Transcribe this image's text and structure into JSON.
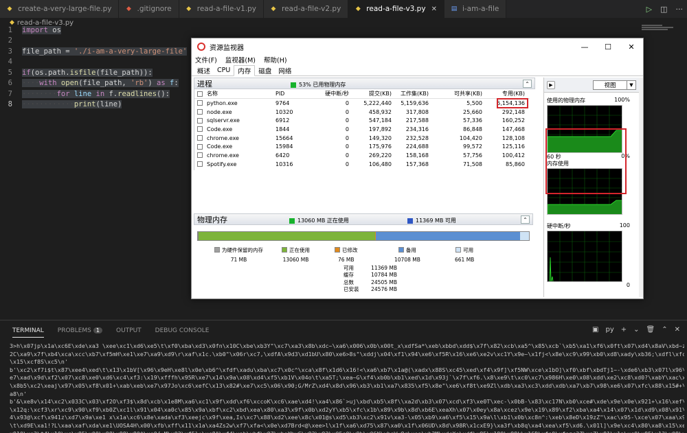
{
  "editor_tabs": [
    {
      "label": "create-a-very-large-file.py",
      "icon": "python-file-icon",
      "active": false
    },
    {
      "label": ".gitignore",
      "icon": "git-icon",
      "active": false
    },
    {
      "label": "read-a-file-v1.py",
      "icon": "python-file-icon",
      "active": false
    },
    {
      "label": "read-a-file-v2.py",
      "icon": "python-file-icon",
      "active": false
    },
    {
      "label": "read-a-file-v3.py",
      "icon": "python-file-icon",
      "active": true
    },
    {
      "label": "i-am-a-file",
      "icon": "file-icon",
      "active": false
    }
  ],
  "breadcrumb": "read-a-file-v3.py",
  "code_lines": [
    {
      "n": "1",
      "html": "<span class=\"kw\">import</span> os"
    },
    {
      "n": "2",
      "html": ""
    },
    {
      "n": "3",
      "html": "file_path = <span class=\"str\">'./i-am-a-very-large-file'</span>"
    },
    {
      "n": "4",
      "html": ""
    },
    {
      "n": "5",
      "html": "<span class=\"kw\">if</span>(os.path.<span class=\"fn\">isfile</span>(file_path)):"
    },
    {
      "n": "6",
      "html": "<span class=\"ws\">····</span><span class=\"kw\">with</span> <span class=\"fn\">open</span>(file_path, <span class=\"str\">'rb'</span>) <span class=\"kw\">as</span> <span class=\"var\">f</span>:"
    },
    {
      "n": "7",
      "html": "<span class=\"ws\">········</span><span class=\"kw\">for</span> <span class=\"var\">line</span> <span class=\"kw\">in</span> f.<span class=\"fn\">readlines</span>():"
    },
    {
      "n": "8",
      "html": "<span class=\"ws\">············</span><span class=\"fn\">print</span>(line)"
    }
  ],
  "panel": {
    "tabs": [
      "TERMINAL",
      "PROBLEMS",
      "OUTPUT",
      "DEBUG CONSOLE"
    ],
    "problems_count": "1",
    "shell": "py",
    "terminal_lines": [
      "3>h\\x07jp\\x1a\\xc6E\\xde\\xa3 \\xee\\xc1\\xd6\\xe5\\t\\xf0\\xba\\xd3\\x0fn\\x10C\\xbe\\xb3Y\"\\xc7\\xa3\\x8b\\xdc~\\xa6\\x006\\x0b\\x00t_x\\xdfSa*\\xeb\\xbbd\\xdd$\\x7f\\x82\\xcb\\xa5^\\x85\\xcb`\\xb5\\xa1\\xf6\\x0ft\\x07\\xd4\\x8aV\\xbd~zpQ3&W\\x81:\\xbfW\\x0e\\xf",
      "2C\\xa9\\x7f\\xb4\\xca\\xcc\\xb7\\xf5mH\\xe1\\xe7\\xa9\\xd9\\r\\xaf\\x1c.\\xb0\"\\x06r\\xc7,\\xdfA\\x9d3\\xd1bU\\x80\\xe6>8s\"\\xddj\\x04\\xf1\\x94\\xe6\\xf5R\\x16\\xe6\\xe2v\\xc1Y\\x9e~\\x1fj<\\x8e\\xc9\\x99\\xb0\\xd8\\xady\\xb36;\\xdfl\\xfcV\\xaaV\\x83\\x05k8[\\xc9",
      "\\x15\\xcf8S\\xc5\\n'",
      "b'\\xc2\\xf7i$t\\x87\\xee4\\xed\\t\\x13\\x1bV[\\x96\\x9eH\\xe8l\\x0e\\xb6^\\xfdf\\xadu\\xba\\xc7\\x0c^\\xca\\x8f\\x1d6\\x16!<\\xa6\\xb7\\x1a@(\\xadx\\x88S\\xc45\\xed\\xf4\\x9f]\\xf5NW\\xce\\x1bO]\\xf0\\xbf\\xbdTj1~-\\xde6\\xb3\\x07l\\x96\\xea\\xa1\\xcfx\\g\\xbc\\xba\\x",
      "e7\\xad\\x9d\\xf2\\x07\\xc8\\xe0\\xd6\\xc4\\xf3:\\x19\\xfffh\\x95R\\xe7\\x14\\x9a\\x08\\xd4\\xf5\\xb1V\\x04o\\t\\xa5T;\\xea~G\\xf4\\xb0b\\xb1\\xed\\x1d\\x93j`\\x7f\\xf6.\\x8\\xe9\\t\\xc0\\xc7\\x986H\\xe0\\x08\\xdd\\xe2\\xc8\\xd0?\\xabY\\xac\\xe7\\xb0\\xad\\x84[\\x13\\x15",
      "\\x8b5\\xc2\\xeaj\\x97\\x05\\xf8\\x01+\\xab\\xeb\\xe7\\x97Jo\\xc6\\xefC\\x13\\x82#\\xe7\\xc5\\x06\\x90;G/MrZ\\xd4\\x8d\\x96\\xb3\\xb1\\xa7\\x835\\xf5\\x8e\"\\xe6\\xf8t\\xe9Zl\\xdb\\xa3\\xc3\\xdd\\xdb\\xa7\\xb7\\x98\\xe6\\x07\\xfc\\x88\\x15#+\\xe9\\x06\\x18\\xea\\x1cl\\x",
      "a8\\n'",
      "b'&\\xe8v\\x14\\xc2\\x033C\\x03\\xf2O\\xf3$\\x8d\\xcb\\x1e8M\\xa6\\xc1\\x9f\\xdd\\xf6\\xccoK\\xc6\\xae\\xd4!\\xa4\\x86`>uj\\xbd\\xb5\\x8f\\\\xa2d\\xb3\\x07\\xcd\\xf3\\xe0T\\xec-\\x0bB-\\x83\\xc17N\\xb0\\xce#\\xde\\x9e\\x0e\\x921+\\x16\\xef\\x18\\xd3L\\xa9\\xd5\\x89z",
      "\\x12q:\\xcf3\\xr\\xc9\\x90\\xf9\\xb0Z\\xc1l\\x91\\x04\\xa0c\\x85\\x9a\\xbf\\xc2\\xbd\\xea\\x80\\xa3\\x9f\\x0b\\xd2yY\\xb5\\xfc\\x1b\\x89\\x9b\\x8d\\xb6E\\xeaXh\\x07\\x0ey\\x8a\\xcez\\x9e\\x19\\x89\\xf2\\xba\\xa4\\x14\\x07\\x1d\\xd9\\x08\\x91\\x19\\xd9\\xb0\\x85;\\xf9\\xa",
      "4\\x93@\\xcf\\x941z\\xd7\\x9a\\xe1 x\\x1a\\xc6\\x8e\\xada\\xf3\\xeejc\\x9f\\xea,Is\\xc7\\x88\\xd2\\xee\\x8c\\x01@s\\xd5\\xb3\\xc2\\x91v\\xa3-\\x05\\xb9\\xa6\\xf5\\x15\\x9a\\l\\xb1\\x0b\\xc8n^:\\xeb\\x8eD\\x19zZ\"\\xac\\x95-\\xce\\x07\\xaa\\x9cd\\x12(:{\\x9a\\x05\\xa4",
      "\\t\\xd9E\\xa1!?L\\xaa\\xaf\\xda\\xe1\\UOSA4H\\x00\\xfb\\xff\\x11\\x1a\\xa4Zs2w\\xf7\\xfa<\\x0e\\xd7Brd<@\\xee>l\\x1f\\xa6\\xd75\\x87\\xa0\\x1f\\x06UD\\x8d\\x98R\\x1cxE9}\\xa3f\\xb8q\\xa4\\xea\\xf5\\xd6.\\x01l]\\x9e\\xc4\\x80\\xa8\\x15\\xec\\x11Rsq$\\x1f\\x8244]%",
      "x910\\xe2\\t4\\x10\\xc\\x85\\x00\\x98\\x99\\x80^\\xe0{:M\\x02\\xf5}+\\xc8\"\\xf4\\xab\\xbf\\x87\\xbeXbyG\\x93\\x92\\x05s0\\x9b\\x06K\\xbaW<8r\\xea\\xb3M\\xdcXe\\xdf\\x85\\x18O\\x99k\\x16D\\xfe0\\xfazc2Z\\xe7\\x81\\x1a\\xc0\\x85\\x13\\x08\\x0e\\xdf\\xaeVY\\xb0E$\\x"
    ]
  },
  "resmon": {
    "title": "资源监视器",
    "menu": [
      "文件(F)",
      "监视器(M)",
      "帮助(H)"
    ],
    "tabs": [
      "概述",
      "CPU",
      "内存",
      "磁盘",
      "网络"
    ],
    "active_tab": "内存",
    "processes": {
      "title": "进程",
      "summary": "53% 已用物理内存",
      "columns": [
        "名称",
        "PID",
        "硬中断/秒",
        "提交(KB)",
        "工作集(KB)",
        "可共享(KB)",
        "专用(KB)"
      ],
      "rows": [
        [
          "python.exe",
          "9764",
          "0",
          "5,222,440",
          "5,159,636",
          "5,500",
          "5,154,136"
        ],
        [
          "node.exe",
          "10320",
          "0",
          "458,932",
          "317,808",
          "25,660",
          "292,148"
        ],
        [
          "sqlservr.exe",
          "6912",
          "0",
          "547,184",
          "217,588",
          "57,336",
          "160,252"
        ],
        [
          "Code.exe",
          "1844",
          "0",
          "197,892",
          "234,316",
          "86,848",
          "147,468"
        ],
        [
          "chrome.exe",
          "15664",
          "0",
          "149,320",
          "232,528",
          "104,420",
          "128,108"
        ],
        [
          "Code.exe",
          "15984",
          "0",
          "175,976",
          "224,688",
          "99,572",
          "125,116"
        ],
        [
          "chrome.exe",
          "6420",
          "0",
          "269,220",
          "158,168",
          "57,756",
          "100,412"
        ],
        [
          "Spotify.exe",
          "10316",
          "0",
          "106,480",
          "157,368",
          "71,508",
          "85,860"
        ]
      ]
    },
    "physical_memory": {
      "title": "物理内存",
      "in_use_text": "13060 MB 正在使用",
      "available_text": "11369 MB 可用",
      "bar_segments": [
        {
          "key": "reserved",
          "mb": 71,
          "color": "#808080"
        },
        {
          "key": "in_use",
          "mb": 13060,
          "color": "#7db43a"
        },
        {
          "key": "modified",
          "mb": 76,
          "color": "#e08a1e"
        },
        {
          "key": "standby",
          "mb": 10708,
          "color": "#5b8fd2"
        },
        {
          "key": "free",
          "mb": 661,
          "color": "#cfe3f5"
        }
      ],
      "legend": [
        {
          "label": "为硬件保留的内存",
          "value": "71 MB",
          "color": "#a0a0a0"
        },
        {
          "label": "正在使用",
          "value": "13060 MB",
          "color": "#7db43a"
        },
        {
          "label": "已修改",
          "value": "76 MB",
          "color": "#e08a1e"
        },
        {
          "label": "备用",
          "value": "10708 MB",
          "color": "#5b8fd2"
        },
        {
          "label": "可用",
          "value": "661 MB",
          "color": "#cfe3f5"
        }
      ],
      "stats": [
        {
          "k": "可用",
          "v": "11369 MB"
        },
        {
          "k": "缓存",
          "v": "10784 MB"
        },
        {
          "k": "总数",
          "v": "24505 MB"
        },
        {
          "k": "已安装",
          "v": "24576 MB"
        }
      ]
    },
    "graphs": {
      "view_label": "视图",
      "used_physical": {
        "label": "使用的物理内存",
        "max": "100%",
        "time": "60 秒",
        "min": "0%"
      },
      "commit": {
        "label": "内存使用"
      },
      "hard_faults": {
        "label": "硬中断/秒",
        "max": "100",
        "min": "0"
      }
    }
  }
}
